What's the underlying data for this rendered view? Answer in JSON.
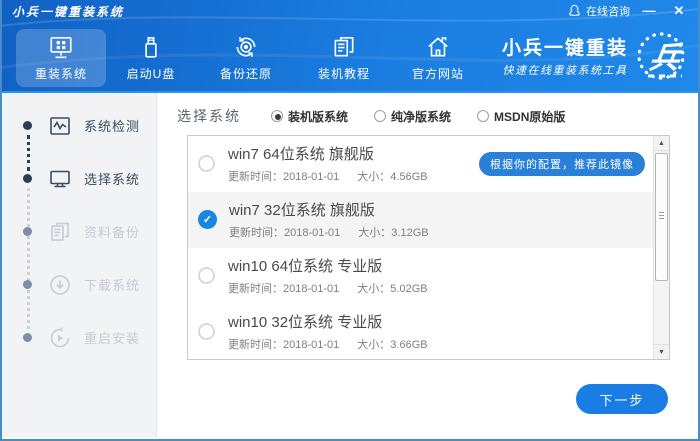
{
  "titlebar": {
    "title": "小兵一键重装系统",
    "online_support": "在线咨询",
    "minimize": "—",
    "close": "✕"
  },
  "nav": {
    "items": [
      {
        "label": "重装系统",
        "icon": "monitor-grid-icon",
        "active": true
      },
      {
        "label": "启动U盘",
        "icon": "usb-drive-icon",
        "active": false
      },
      {
        "label": "备份还原",
        "icon": "backup-restore-icon",
        "active": false
      },
      {
        "label": "装机教程",
        "icon": "tutorial-docs-icon",
        "active": false
      },
      {
        "label": "官方网站",
        "icon": "official-site-home-icon",
        "active": false
      }
    ],
    "brand": {
      "name": "小兵一键重装",
      "tagline": "快速在线重装系统工具"
    }
  },
  "sidebar": {
    "steps": [
      {
        "label": "系统检测",
        "state": "done"
      },
      {
        "label": "选择系统",
        "state": "active"
      },
      {
        "label": "资料备份",
        "state": "pending"
      },
      {
        "label": "下载系统",
        "state": "pending"
      },
      {
        "label": "重启安装",
        "state": "pending"
      }
    ]
  },
  "main": {
    "section_label": "选择系统",
    "edition_options": [
      {
        "label": "装机版系统",
        "selected": true
      },
      {
        "label": "纯净版系统",
        "selected": false
      },
      {
        "label": "MSDN原始版",
        "selected": false
      }
    ],
    "systems": [
      {
        "name": "win7 64位系统 旗舰版",
        "updated": "更新时间：2018-01-01",
        "size": "大小：4.56GB",
        "badge": "根据你的配置，推荐此镜像",
        "selected": false
      },
      {
        "name": "win7 32位系统 旗舰版",
        "updated": "更新时间：2018-01-01",
        "size": "大小：3.12GB",
        "selected": true
      },
      {
        "name": "win10 64位系统 专业版",
        "updated": "更新时间：2018-01-01",
        "size": "大小：5.02GB",
        "selected": false
      },
      {
        "name": "win10 32位系统 专业版",
        "updated": "更新时间：2018-01-01",
        "size": "大小：3.66GB",
        "selected": false
      }
    ],
    "next_button_label": "下一步"
  },
  "colors": {
    "header_blue": "#1b7de0",
    "accent_blue": "#1a7de4",
    "badge_blue": "#2a7fd8",
    "step_done": "#2c3d53",
    "step_pending": "#c6cbd4"
  }
}
